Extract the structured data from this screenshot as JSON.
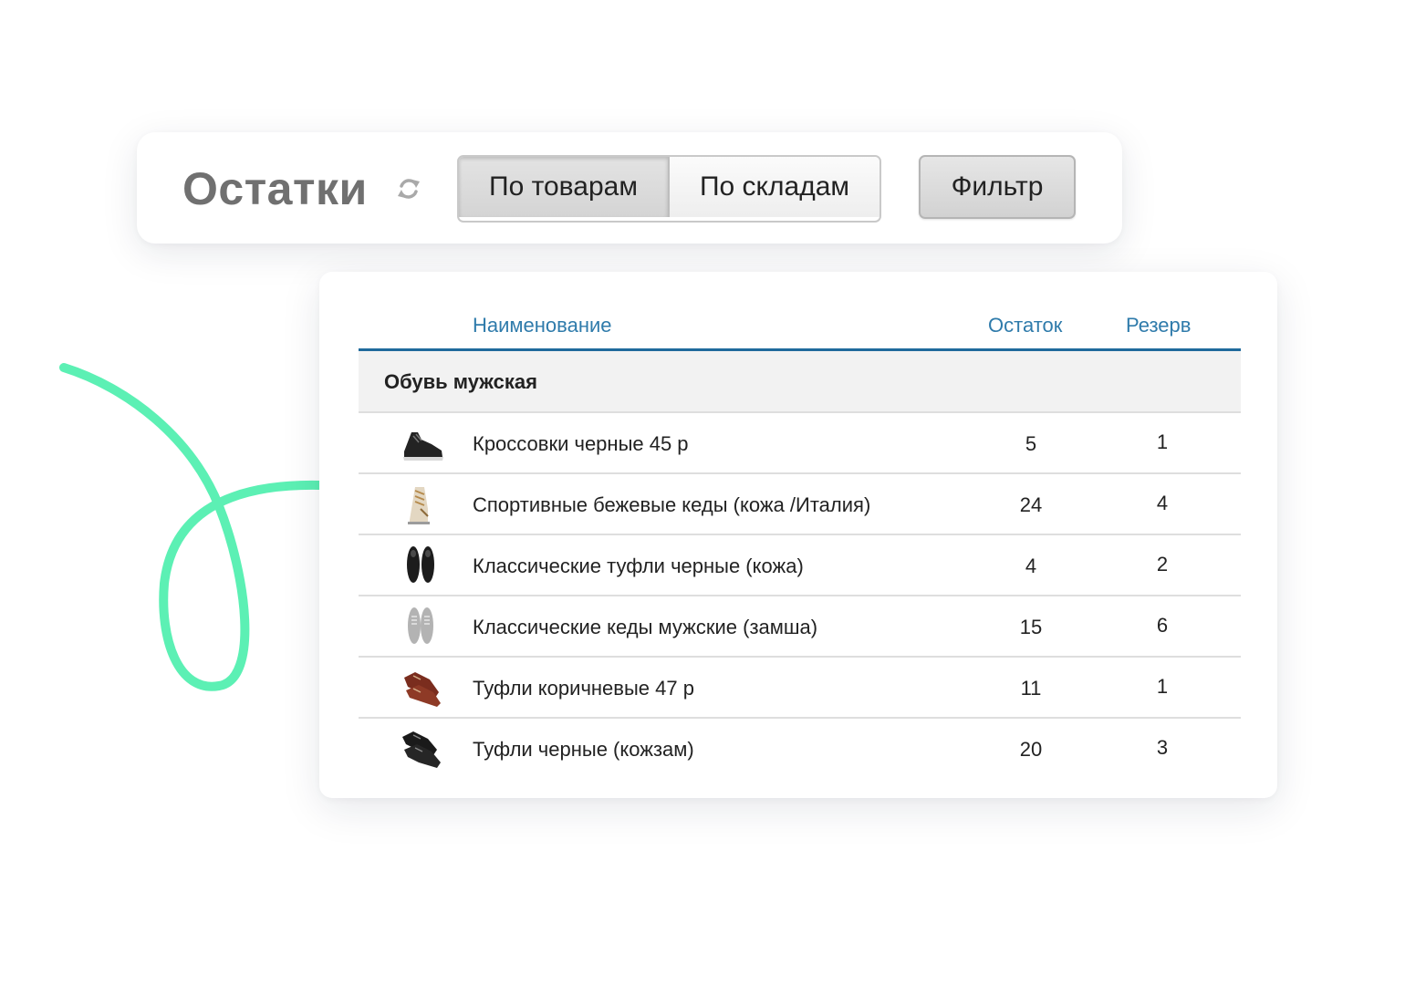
{
  "header": {
    "title": "Остатки",
    "refresh_icon": "refresh-icon",
    "view_tabs": [
      {
        "label": "По товарам",
        "active": true
      },
      {
        "label": "По складам",
        "active": false
      }
    ],
    "filter_label": "Фильтр"
  },
  "table": {
    "columns": {
      "name": "Наименование",
      "stock": "Остаток",
      "reserve": "Резерв"
    },
    "group": "Обувь мужская",
    "rows": [
      {
        "icon": "black-sneaker-icon",
        "name": "Кроссовки черные 45 р",
        "stock": "5",
        "reserve": "1"
      },
      {
        "icon": "beige-sneaker-icon",
        "name": "Спортивные бежевые кеды (кожа /Италия)",
        "stock": "24",
        "reserve": "4"
      },
      {
        "icon": "black-loafer-icon",
        "name": "Классические туфли черные (кожа)",
        "stock": "4",
        "reserve": "2"
      },
      {
        "icon": "grey-suede-sneaker-icon",
        "name": "Классические кеды мужские (замша)",
        "stock": "15",
        "reserve": "6"
      },
      {
        "icon": "brown-oxford-icon",
        "name": "Туфли коричневые 47 р",
        "stock": "11",
        "reserve": "1"
      },
      {
        "icon": "black-dress-shoe-icon",
        "name": "Туфли черные (кожзам)",
        "stock": "20",
        "reserve": "3"
      }
    ]
  },
  "colors": {
    "accent": "#1f6a9c",
    "header_text": "#2f7bab",
    "squiggle": "#5cf0b4",
    "title": "#707070"
  }
}
